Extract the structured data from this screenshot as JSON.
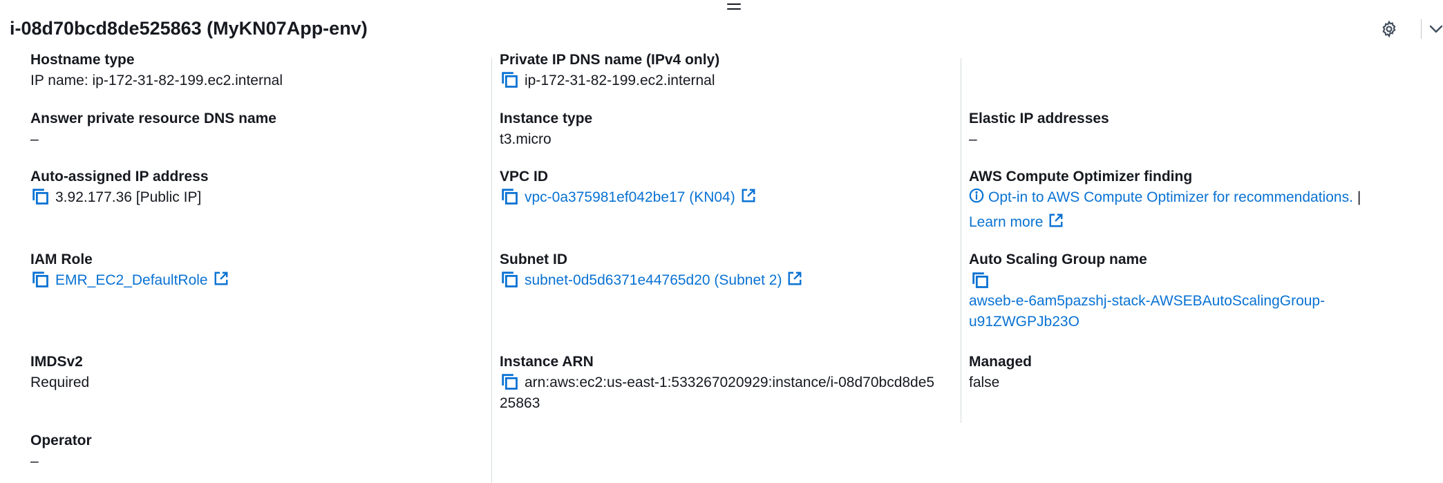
{
  "header": {
    "title": "i-08d70bcd8de525863 (MyKN07App-env)"
  },
  "fields": {
    "hostname_type": {
      "label": "Hostname type",
      "value": "IP name: ip-172-31-82-199.ec2.internal"
    },
    "private_dns": {
      "label": "Private IP DNS name (IPv4 only)",
      "value": "ip-172-31-82-199.ec2.internal"
    },
    "answer_dns": {
      "label": "Answer private resource DNS name",
      "value": "–"
    },
    "instance_type": {
      "label": "Instance type",
      "value": "t3.micro"
    },
    "elastic_ip": {
      "label": "Elastic IP addresses",
      "value": "–"
    },
    "auto_ip": {
      "label": "Auto-assigned IP address",
      "value": "3.92.177.36 [Public IP]"
    },
    "vpc_id": {
      "label": "VPC ID",
      "value": "vpc-0a375981ef042be17 (KN04)"
    },
    "optimizer": {
      "label": "AWS Compute Optimizer finding",
      "link": "Opt-in to AWS Compute Optimizer for recommendations.",
      "separator": "|",
      "learn_more": "Learn more"
    },
    "iam_role": {
      "label": "IAM Role",
      "value": "EMR_EC2_DefaultRole"
    },
    "subnet_id": {
      "label": "Subnet ID",
      "value": "subnet-0d5d6371e44765d20 (Subnet 2)"
    },
    "asg_name": {
      "label": "Auto Scaling Group name",
      "value_line1": "awseb-e-6am5pazshj-stack-AWSEBAutoScalingGroup-",
      "value_line2": "u91ZWGPJb23O"
    },
    "imdsv2": {
      "label": "IMDSv2",
      "value": "Required"
    },
    "instance_arn": {
      "label": "Instance ARN",
      "value_line1": "arn:aws:ec2:us-east-1:533267020929:instance/i-08d70bcd8de5",
      "value_line2": "25863"
    },
    "managed": {
      "label": "Managed",
      "value": "false"
    },
    "operator": {
      "label": "Operator",
      "value": "–"
    }
  },
  "icons": {
    "copy": "copy-icon",
    "external": "external-link-icon",
    "info": "info-icon",
    "settings": "gear-icon",
    "collapse": "chevron-down-icon",
    "drag": "drag-handle-icon"
  },
  "colors": {
    "link": "#0972d3",
    "text": "#16191f",
    "divider": "#d5dbdb"
  }
}
